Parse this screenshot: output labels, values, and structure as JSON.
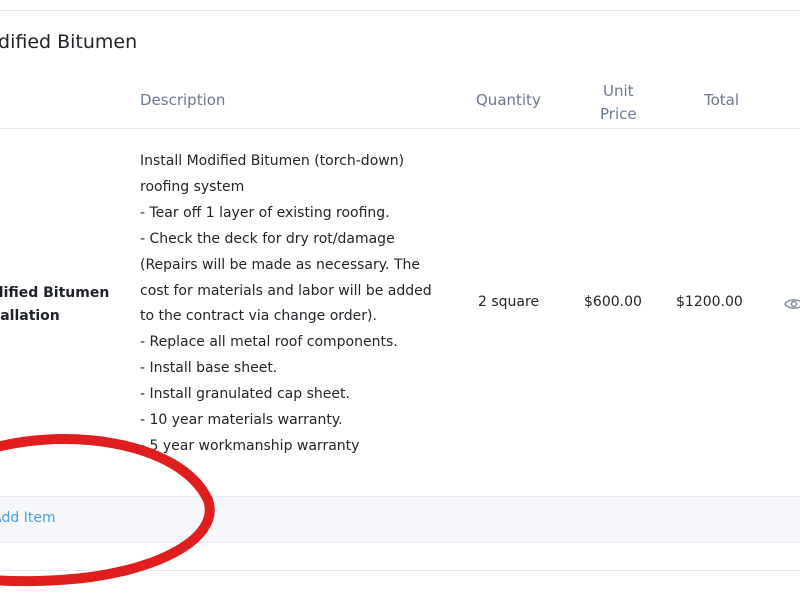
{
  "section": {
    "title": "Modified Bitumen"
  },
  "table": {
    "headers": {
      "description": "Description",
      "quantity": "Quantity",
      "unit_price_line1": "Unit",
      "unit_price_line2": "Price",
      "total": "Total"
    },
    "rows": [
      {
        "name_line1": "Modified Bitumen",
        "name_line2": "Installation",
        "description_lines": [
          "Install Modified Bitumen (torch-down)",
          "roofing system",
          "- Tear off 1 layer of existing roofing.",
          "- Check the deck for dry rot/damage",
          "(Repairs will be made as necessary. The",
          "cost for materials and labor will be added",
          "to the contract via change order).",
          "- Replace all metal roof components.",
          "- Install base sheet.",
          "- Install granulated cap sheet.",
          "- 10 year materials warranty.",
          "- 5 year workmanship warranty"
        ],
        "quantity": "2 square",
        "unit_price": "$600.00",
        "total": "$1200.00",
        "action_icon": "eye-icon"
      }
    ],
    "add_item_label": "+ Add Item"
  },
  "colors": {
    "header_text": "#6b7a90",
    "link": "#4aa3e0",
    "annotation": "#e01e1e",
    "add_row_bg": "#f5f7fa"
  }
}
